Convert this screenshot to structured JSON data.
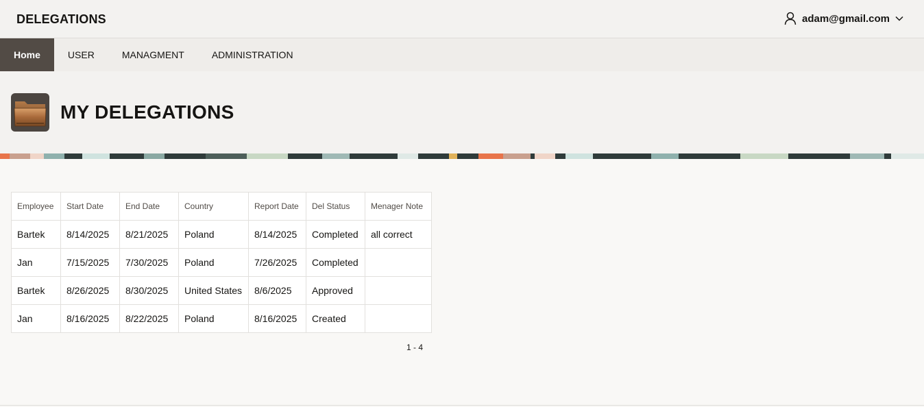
{
  "header": {
    "app_title": "DELEGATIONS",
    "user_email": "adam@gmail.com",
    "user_icon": "user-icon",
    "dropdown_icon": "chevron-down-icon"
  },
  "nav": {
    "items": [
      {
        "label": "Home",
        "active": true
      },
      {
        "label": "USER",
        "active": false
      },
      {
        "label": "MANAGMENT",
        "active": false
      },
      {
        "label": "ADMINISTRATION",
        "active": false
      }
    ]
  },
  "hero": {
    "icon": "folder-icon",
    "title": "MY DELEGATIONS"
  },
  "report": {
    "columns": [
      "Employee",
      "Start Date",
      "End Date",
      "Country",
      "Report Date",
      "Del Status",
      "Menager Note"
    ],
    "rows": [
      [
        "Bartek",
        "8/14/2025",
        "8/21/2025",
        "Poland",
        "8/14/2025",
        "Completed",
        "all correct"
      ],
      [
        "Jan",
        "7/15/2025",
        "7/30/2025",
        "Poland",
        "7/26/2025",
        "Completed",
        ""
      ],
      [
        "Bartek",
        "8/26/2025",
        "8/30/2025",
        "United States",
        "8/6/2025",
        "Approved",
        ""
      ],
      [
        "Jan",
        "8/16/2025",
        "8/22/2025",
        "Poland",
        "8/16/2025",
        "Created",
        ""
      ]
    ],
    "pagination": "1 - 4"
  },
  "colors": {
    "nav_active_bg": "#524b45",
    "header_bg": "#f3f2f0",
    "page_bg": "#f9f8f6"
  }
}
